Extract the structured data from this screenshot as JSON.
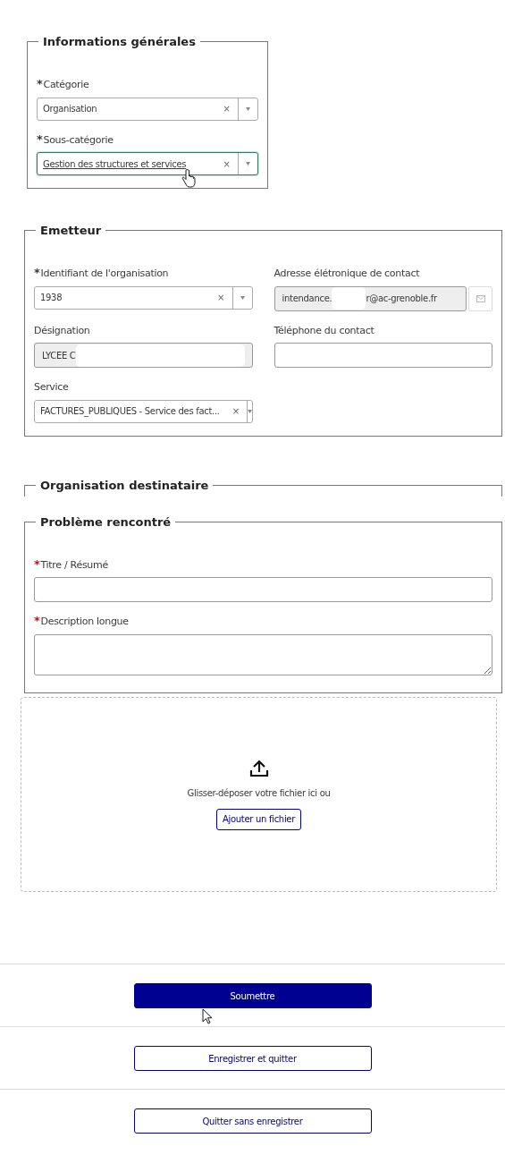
{
  "sections": [
    {
      "legend": "Informations générales",
      "kind": "narrow",
      "rows": [
        [
          {
            "kind": "select",
            "label": "Catégorie",
            "required_mark": "*",
            "color": "#3a3a3a",
            "value": "Organisation",
            "clear": "×",
            "focused": false
          }
        ],
        [
          {
            "kind": "select",
            "label": "Sous-catégorie",
            "required_mark": "*",
            "color": "#3a3a3a",
            "value": "Gestion des structures et services",
            "clear": "×",
            "focused": true
          }
        ]
      ]
    },
    {
      "legend": "Emetteur",
      "kind": "grid",
      "rows": [
        [
          {
            "kind": "select",
            "label": "Identifiant de l'organisation",
            "required_mark": "*",
            "color": "#3a3a3a",
            "value": "1938",
            "clear": "×",
            "focused": false
          },
          {
            "kind": "email",
            "label": "Adresse élétronique de contact",
            "value": "intendance.",
            "value_after": "r@ac-grenoble.fr",
            "redacted": true
          }
        ],
        [
          {
            "kind": "readonly",
            "label": "Désignation",
            "value": "LYCEE C",
            "redacted": true
          },
          {
            "kind": "input",
            "label": "Téléphone du contact"
          }
        ],
        [
          {
            "kind": "select",
            "label": "Service",
            "value": "FACTURES_PUBLIQUES - Service des fact...",
            "clear": "×",
            "focused": false
          }
        ]
      ]
    },
    {
      "legend": "Organisation destinataire",
      "kind": "open"
    },
    {
      "legend": "Problème rencontré",
      "kind": "wide",
      "rows": [
        [
          {
            "kind": "input",
            "label": "Titre / Résumé",
            "required_mark": "*",
            "color": "#e1000f"
          }
        ],
        [
          {
            "kind": "textarea",
            "label": "Description longue",
            "required_mark": "*",
            "color": "#e1000f"
          }
        ]
      ]
    }
  ],
  "dropzone": {
    "text": "Glisser-déposer votre fichier ici ou",
    "button": "Ajouter un fichier"
  },
  "actions": [
    {
      "label": "Soumettre",
      "primary": true
    },
    {
      "label": "Enregistrer et quitter",
      "primary": false
    },
    {
      "label": "Quitter sans enregistrer",
      "primary": false
    }
  ]
}
